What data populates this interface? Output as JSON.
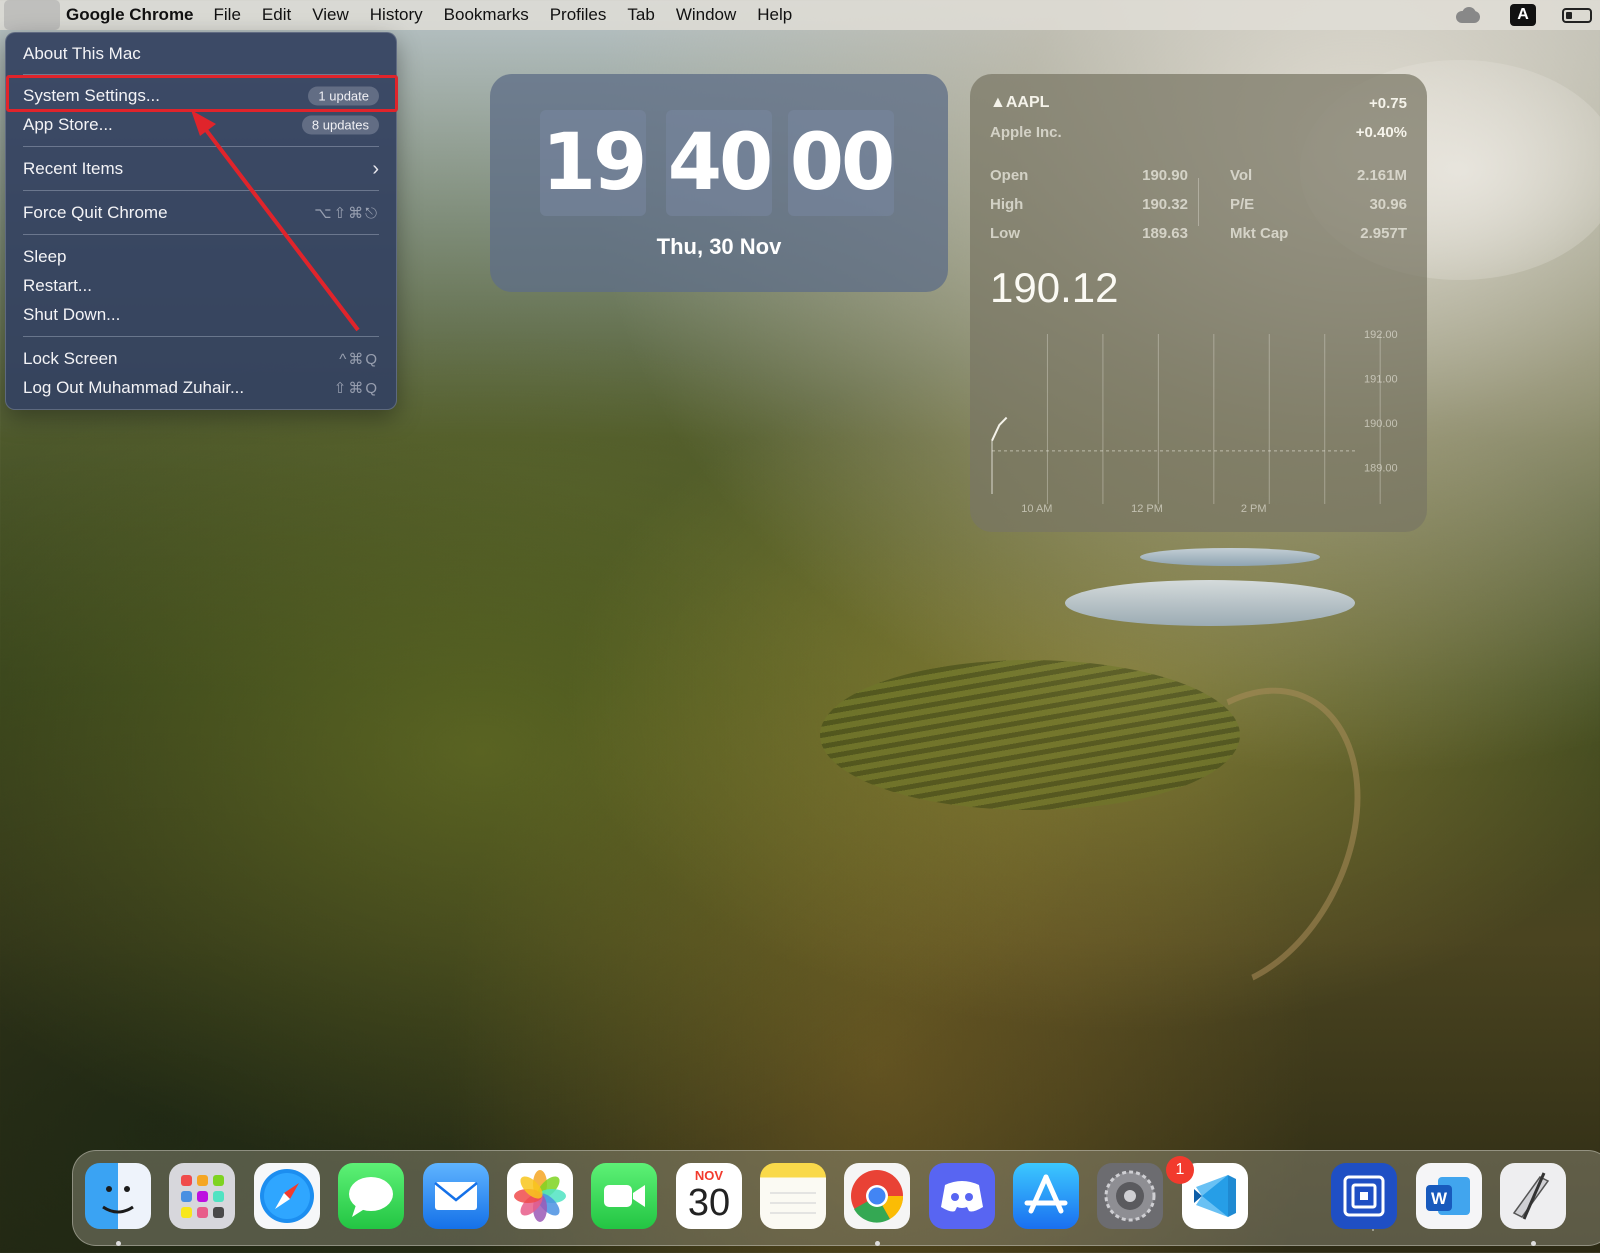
{
  "menubar": {
    "app_name": "Google Chrome",
    "menus": [
      "File",
      "Edit",
      "View",
      "History",
      "Bookmarks",
      "Profiles",
      "Tab",
      "Window",
      "Help"
    ],
    "input_source": "A",
    "icons": [
      "apple-icon",
      "cloud-icon",
      "battery-icon"
    ]
  },
  "apple_menu": {
    "about": "About This Mac",
    "system_settings": "System Settings...",
    "system_settings_badge": "1 update",
    "app_store": "App Store...",
    "app_store_badge": "8 updates",
    "recent_items": "Recent Items",
    "force_quit": "Force Quit Chrome",
    "force_quit_shortcut": "⌥⇧⌘⎋",
    "sleep": "Sleep",
    "restart": "Restart...",
    "shut_down": "Shut Down...",
    "lock_screen": "Lock Screen",
    "lock_screen_shortcut": "^⌘Q",
    "log_out": "Log Out Muhammad Zuhair...",
    "log_out_shortcut": "⇧⌘Q",
    "highlight_color": "#e0242b"
  },
  "clock_widget": {
    "hours": "19",
    "minutes": "40",
    "seconds": "00",
    "date": "Thu, 30 Nov"
  },
  "stock_widget": {
    "symbol": "▲AAPL",
    "company": "Apple Inc.",
    "change": "+0.75",
    "change_pct": "+0.40%",
    "stats": [
      {
        "label": "Open",
        "value": "190.90"
      },
      {
        "label": "High",
        "value": "190.32"
      },
      {
        "label": "Low",
        "value": "189.63"
      },
      {
        "label": "Vol",
        "value": "2.161M"
      },
      {
        "label": "P/E",
        "value": "30.96"
      },
      {
        "label": "Mkt Cap",
        "value": "2.957T"
      }
    ],
    "price": "190.12",
    "y_ticks": [
      "192.00",
      "191.00",
      "190.00",
      "189.00"
    ],
    "x_ticks": [
      "10 AM",
      "12 PM",
      "2 PM"
    ]
  },
  "chart_data": {
    "type": "line",
    "title": "",
    "xlabel": "",
    "ylabel": "",
    "ylim": [
      188.4,
      192.0
    ],
    "x_ticks": [
      "10 AM",
      "12 PM",
      "2 PM"
    ],
    "y_ticks": [
      192.0,
      191.0,
      190.0,
      189.0
    ],
    "previous_close": 189.37,
    "series": [
      {
        "x": [
          0,
          0.02,
          0.04
        ],
        "values": [
          189.6,
          189.95,
          190.12
        ]
      }
    ]
  },
  "calendar_icon": {
    "month": "NOV",
    "day": "30"
  },
  "settings_badge": "1",
  "dock": [
    {
      "name": "finder-icon"
    },
    {
      "name": "launchpad-icon"
    },
    {
      "name": "safari-icon"
    },
    {
      "name": "messages-icon"
    },
    {
      "name": "mail-icon"
    },
    {
      "name": "photos-icon"
    },
    {
      "name": "facetime-icon"
    },
    {
      "name": "calendar-icon"
    },
    {
      "name": "notes-icon"
    },
    {
      "name": "chrome-icon"
    },
    {
      "name": "discord-icon"
    },
    {
      "name": "app-store-icon"
    },
    {
      "name": "system-settings-icon"
    },
    {
      "name": "vscode-icon"
    },
    {
      "name": "screen-capture-icon"
    },
    {
      "name": "word-icon"
    },
    {
      "name": "script-editor-icon"
    }
  ]
}
